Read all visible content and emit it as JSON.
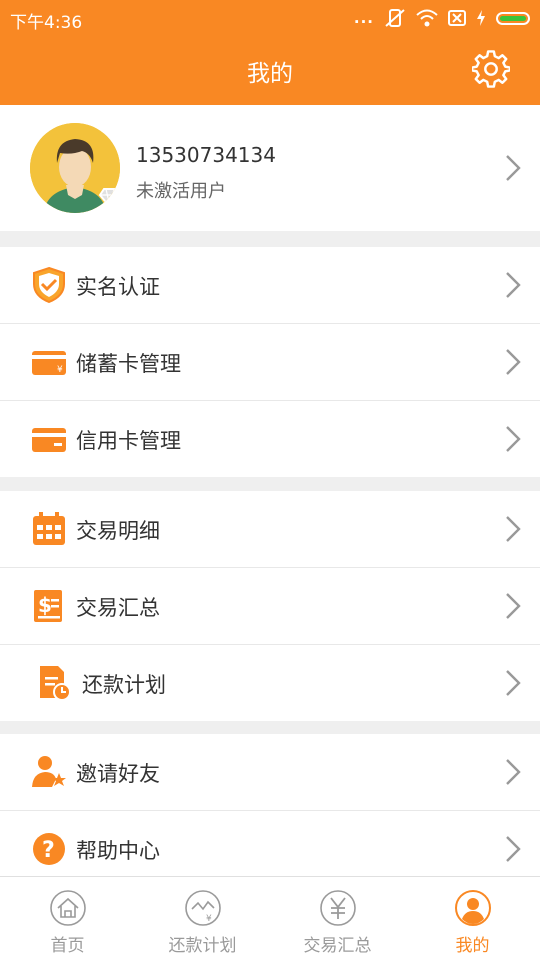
{
  "status_bar": {
    "time": "下午4:36",
    "dots": "..."
  },
  "header": {
    "title": "我的"
  },
  "profile": {
    "phone": "13530734134",
    "status": "未激活用户"
  },
  "groups": [
    {
      "items": [
        {
          "label": "实名认证",
          "icon": "shield-check-icon"
        },
        {
          "label": "储蓄卡管理",
          "icon": "debit-card-icon"
        },
        {
          "label": "信用卡管理",
          "icon": "credit-card-icon"
        }
      ]
    },
    {
      "items": [
        {
          "label": "交易明细",
          "icon": "calendar-icon"
        },
        {
          "label": "交易汇总",
          "icon": "summary-dollar-icon"
        },
        {
          "label": "还款计划",
          "icon": "repayment-plan-icon"
        }
      ]
    },
    {
      "items": [
        {
          "label": "邀请好友",
          "icon": "invite-user-icon"
        },
        {
          "label": "帮助中心",
          "icon": "help-icon"
        }
      ]
    }
  ],
  "tabs": [
    {
      "label": "首页",
      "icon": "home-icon",
      "active": false
    },
    {
      "label": "还款计划",
      "icon": "repayment-chart-icon",
      "active": false
    },
    {
      "label": "交易汇总",
      "icon": "yen-circle-icon",
      "active": false
    },
    {
      "label": "我的",
      "icon": "user-circle-icon",
      "active": true
    }
  ],
  "colors": {
    "accent": "#f98823",
    "background": "#efefef",
    "text": "#333333",
    "muted": "#9a9a9a"
  }
}
